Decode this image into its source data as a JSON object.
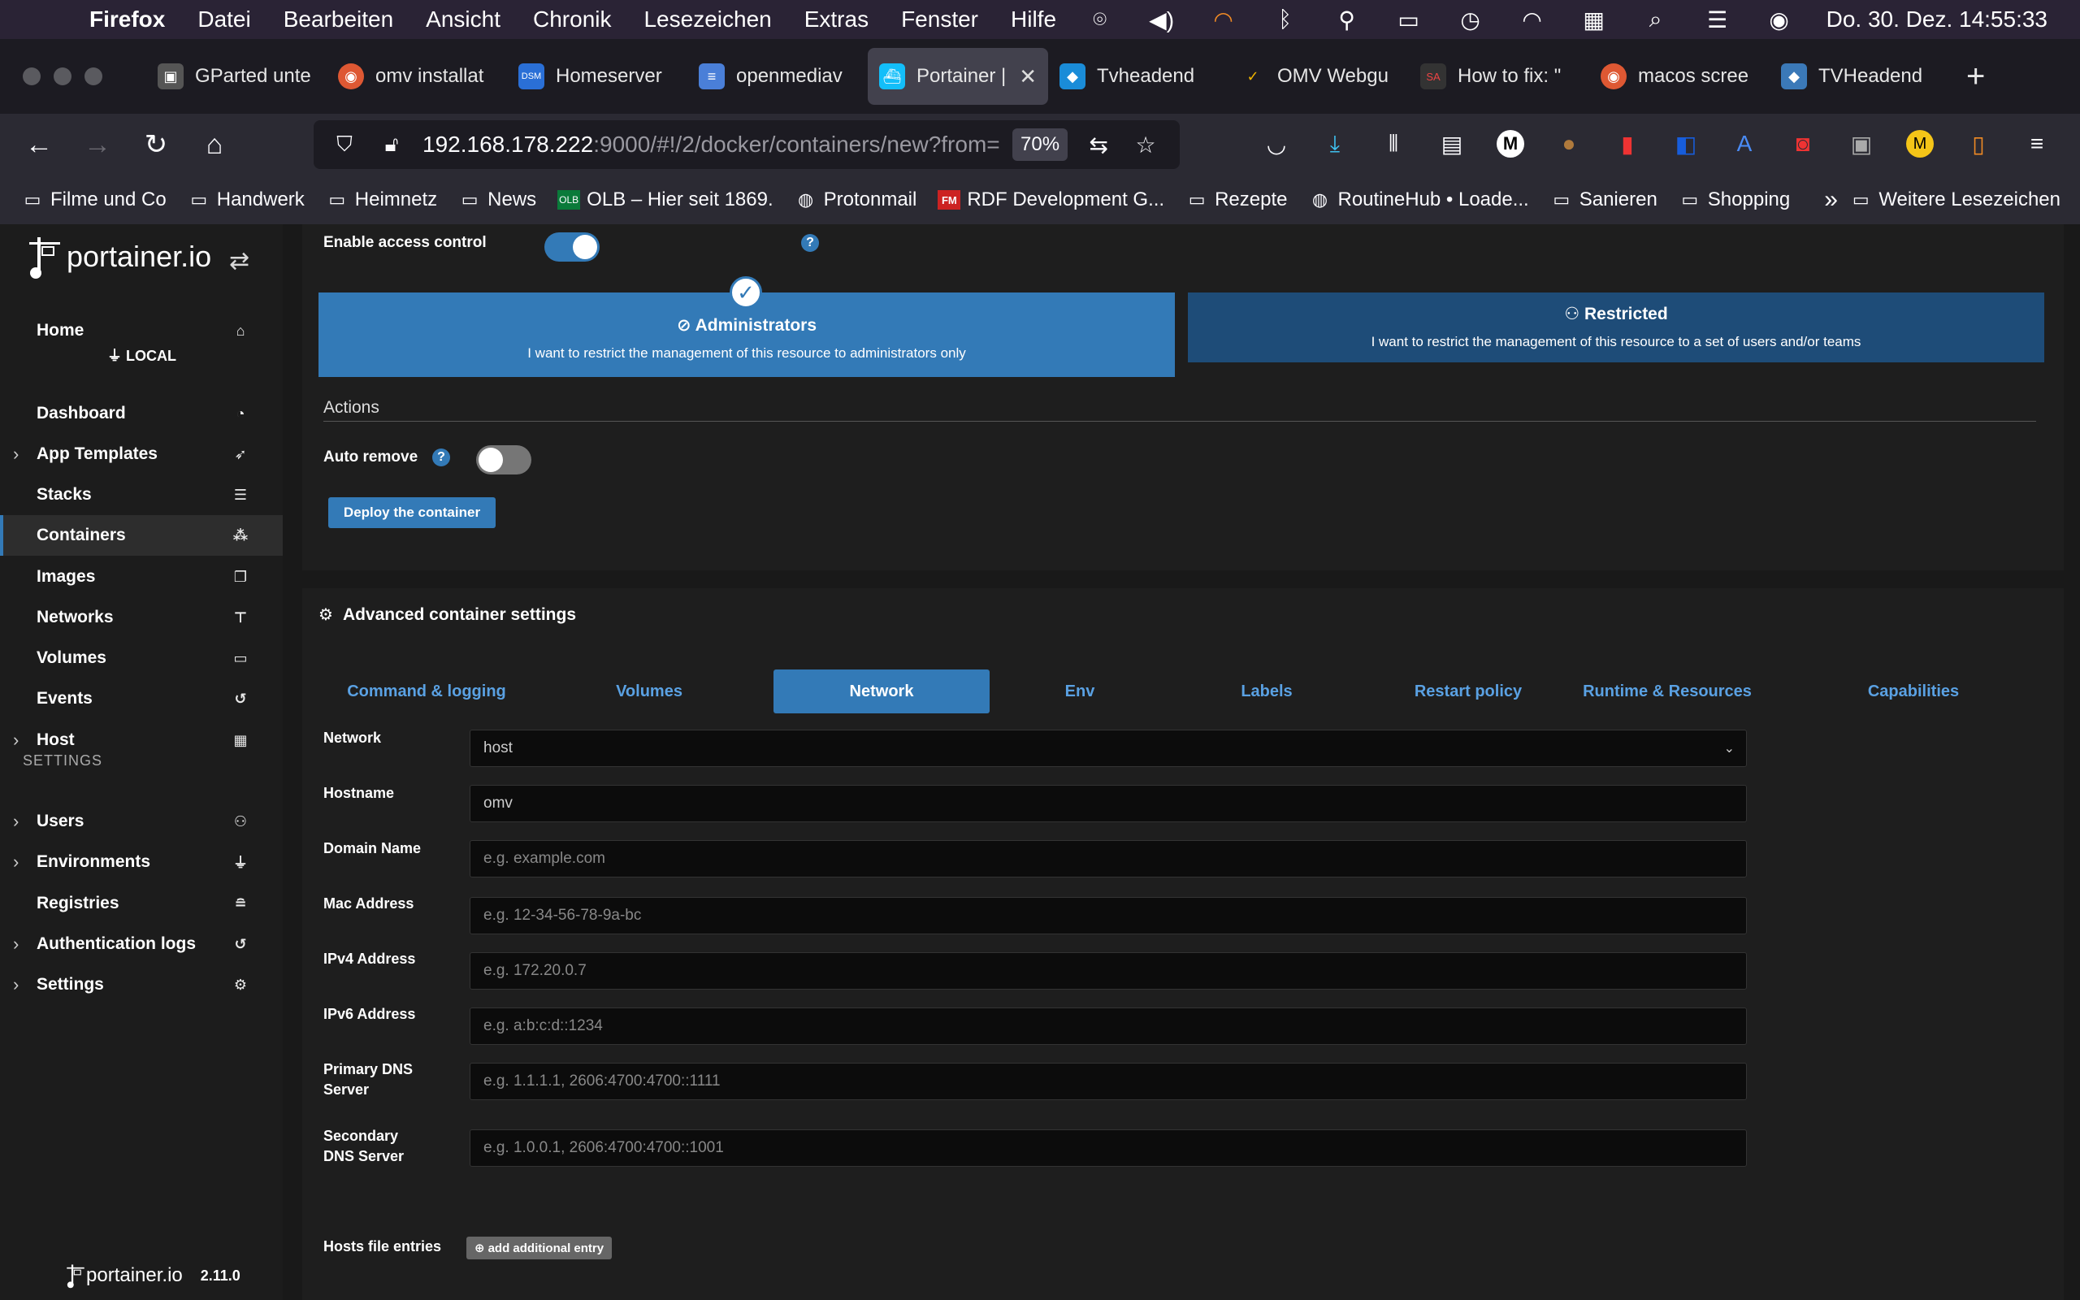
{
  "menubar": {
    "app": "Firefox",
    "items": [
      "Datei",
      "Bearbeiten",
      "Ansicht",
      "Chronik",
      "Lesezeichen",
      "Extras",
      "Fenster",
      "Hilfe"
    ],
    "datetime": "Do. 30. Dez.  14:55:33"
  },
  "tabs": [
    {
      "title": "GParted unte",
      "icon": "gparted-icon",
      "color": "#555555"
    },
    {
      "title": "omv installat",
      "icon": "duckduckgo-icon",
      "color": "#de5833"
    },
    {
      "title": "Homeserver",
      "icon": "dsm-icon",
      "color": "#2a6fd6"
    },
    {
      "title": "openmediav",
      "icon": "document-icon",
      "color": "#4a7fd8"
    },
    {
      "title": "Portainer |",
      "icon": "portainer-icon",
      "color": "#13bef9",
      "active": true
    },
    {
      "title": "Tvheadend",
      "icon": "tvheadend-icon",
      "color": "#1a8cd8"
    },
    {
      "title": "OMV Webgu",
      "icon": "omv-icon",
      "color": "#f0b400"
    },
    {
      "title": "How to fix: \"",
      "icon": "sa-icon",
      "color": "#333333"
    },
    {
      "title": "macos scree",
      "icon": "duckduckgo-icon",
      "color": "#de5833"
    },
    {
      "title": "TVHeadend",
      "icon": "tvheadend-icon",
      "color": "#3b79b8"
    }
  ],
  "nav": {
    "url_host": "192.168.178.222",
    "url_rest": ":9000/#!/2/docker/containers/new?from=",
    "zoom": "70%"
  },
  "bookmarks": [
    "Filme und Co",
    "Handwerk",
    "Heimnetz",
    "News",
    "OLB – Hier seit 1869.",
    "Protonmail",
    "RDF Development G...",
    "Rezepte",
    "RoutineHub • Loade...",
    "Sanieren",
    "Shopping",
    "Weitere Lesezeichen"
  ],
  "sidebar": {
    "brand": "portainer.io",
    "home": "Home",
    "endpoint": "LOCAL",
    "items": [
      {
        "label": "Dashboard",
        "icon": "tachometer-icon"
      },
      {
        "label": "App Templates",
        "icon": "rocket-icon",
        "chev": true
      },
      {
        "label": "Stacks",
        "icon": "list-icon"
      },
      {
        "label": "Containers",
        "icon": "cubes-icon",
        "active": true
      },
      {
        "label": "Images",
        "icon": "clone-icon"
      },
      {
        "label": "Networks",
        "icon": "sitemap-icon"
      },
      {
        "label": "Volumes",
        "icon": "hdd-icon"
      },
      {
        "label": "Events",
        "icon": "history-icon"
      },
      {
        "label": "Host",
        "icon": "th-icon",
        "chev": true
      }
    ],
    "settings_heading": "SETTINGS",
    "settings_items": [
      {
        "label": "Users",
        "icon": "users-icon",
        "chev": true
      },
      {
        "label": "Environments",
        "icon": "plug-icon",
        "chev": true
      },
      {
        "label": "Registries",
        "icon": "database-icon"
      },
      {
        "label": "Authentication logs",
        "icon": "history-icon",
        "chev": true
      },
      {
        "label": "Settings",
        "icon": "cogs-icon",
        "chev": true
      }
    ],
    "version": "2.11.0"
  },
  "access": {
    "label": "Enable access control",
    "enabled": true,
    "admin_title": "Administrators",
    "admin_desc": "I want to restrict the management of this resource to administrators only",
    "restricted_title": "Restricted",
    "restricted_desc": "I want to restrict the management of this resource to a set of users and/or teams"
  },
  "actions": {
    "title": "Actions",
    "auto_remove_label": "Auto remove",
    "auto_remove": false,
    "deploy_label": "Deploy the container"
  },
  "advanced": {
    "title": "Advanced container settings",
    "tabs": [
      "Command & logging",
      "Volumes",
      "Network",
      "Env",
      "Labels",
      "Restart policy",
      "Runtime & Resources",
      "Capabilities"
    ],
    "active_tab": "Network",
    "fields": {
      "network": {
        "label": "Network",
        "value": "host"
      },
      "hostname": {
        "label": "Hostname",
        "value": "omv"
      },
      "domain": {
        "label": "Domain Name",
        "placeholder": "e.g. example.com"
      },
      "mac": {
        "label": "Mac Address",
        "placeholder": "e.g. 12-34-56-78-9a-bc"
      },
      "ipv4": {
        "label": "IPv4 Address",
        "placeholder": "e.g. 172.20.0.7"
      },
      "ipv6": {
        "label": "IPv6 Address",
        "placeholder": "e.g. a:b:c:d::1234"
      },
      "dns1": {
        "label1": "Primary DNS",
        "label2": "Server",
        "placeholder": "e.g. 1.1.1.1, 2606:4700:4700::1111"
      },
      "dns2": {
        "label1": "Secondary",
        "label2": "DNS Server",
        "placeholder": "e.g. 1.0.0.1, 2606:4700:4700::1001"
      },
      "hosts": {
        "label": "Hosts file entries",
        "button": "add additional entry"
      }
    }
  }
}
